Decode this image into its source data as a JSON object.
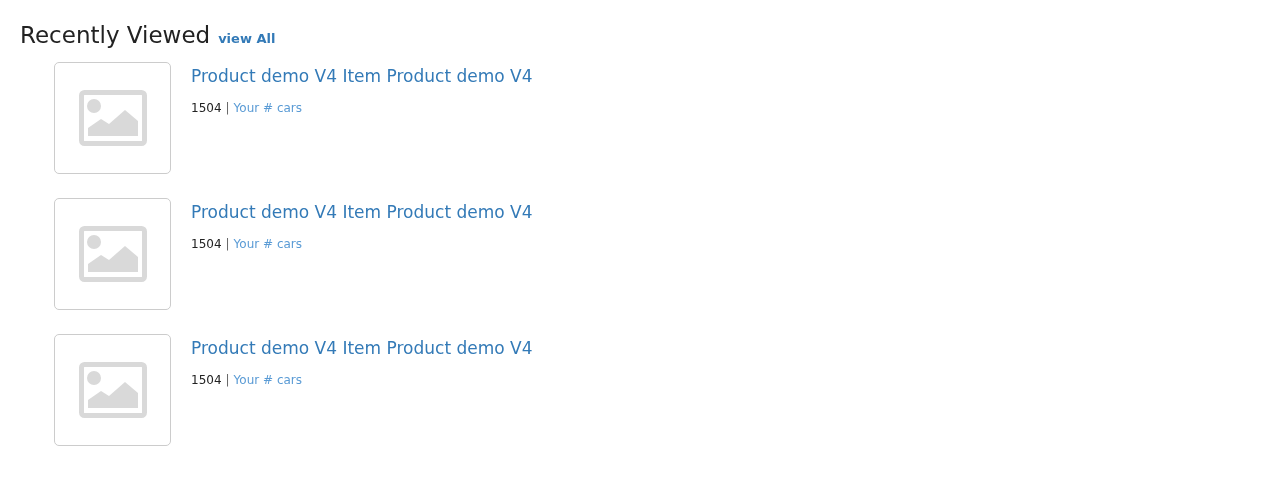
{
  "heading": {
    "title": "Recently Viewed",
    "link": "view All"
  },
  "items": [
    {
      "title": "Product demo V4 Item Product demo V4",
      "number": "1504",
      "separator": "|",
      "link": "Your # cars"
    },
    {
      "title": "Product demo V4 Item Product demo V4",
      "number": "1504",
      "separator": "|",
      "link": "Your # cars"
    },
    {
      "title": "Product demo V4 Item Product demo V4",
      "number": "1504",
      "separator": "|",
      "link": "Your # cars"
    }
  ]
}
